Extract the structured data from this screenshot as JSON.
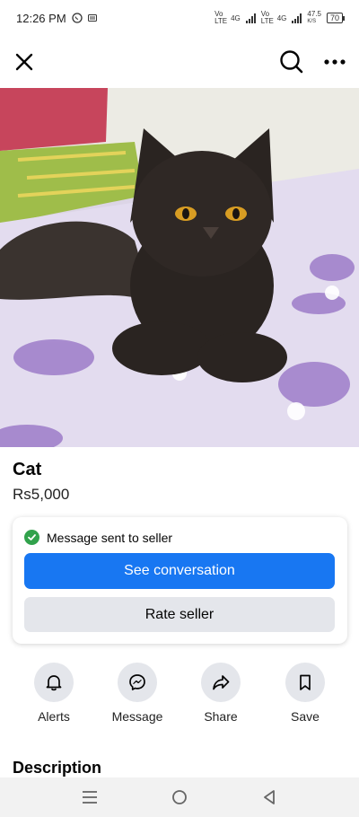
{
  "status_bar": {
    "time": "12:26 PM",
    "net1": "Vo LTE",
    "net1_type": "4G",
    "net2": "Vo LTE",
    "net2_type": "4G",
    "speed": "47.5",
    "speed_unit": "K/S",
    "battery": "70",
    "icons": [
      "whatsapp-icon",
      "message-icon",
      "signal-icon",
      "battery-icon"
    ]
  },
  "top_bar": {
    "icons": [
      "close-icon",
      "search-icon",
      "more-icon"
    ]
  },
  "listing": {
    "photo": "cat-photo",
    "photo_count": 2,
    "current_photo": 1,
    "title": "Cat",
    "price": "Rs5,000"
  },
  "message_card": {
    "status_text": "Message sent to seller",
    "primary_button": "See conversation",
    "secondary_button": "Rate seller",
    "colors": {
      "primary": "#1877f2",
      "secondary": "#e4e6eb",
      "success": "#31a24c"
    }
  },
  "actions": [
    {
      "label": "Alerts",
      "icon": "bell-icon"
    },
    {
      "label": "Message",
      "icon": "messenger-icon"
    },
    {
      "label": "Share",
      "icon": "share-icon"
    },
    {
      "label": "Save",
      "icon": "bookmark-icon"
    }
  ],
  "description_heading": "Description",
  "nav_bar": {
    "icons": [
      "menu-icon",
      "home-icon",
      "back-icon"
    ]
  }
}
